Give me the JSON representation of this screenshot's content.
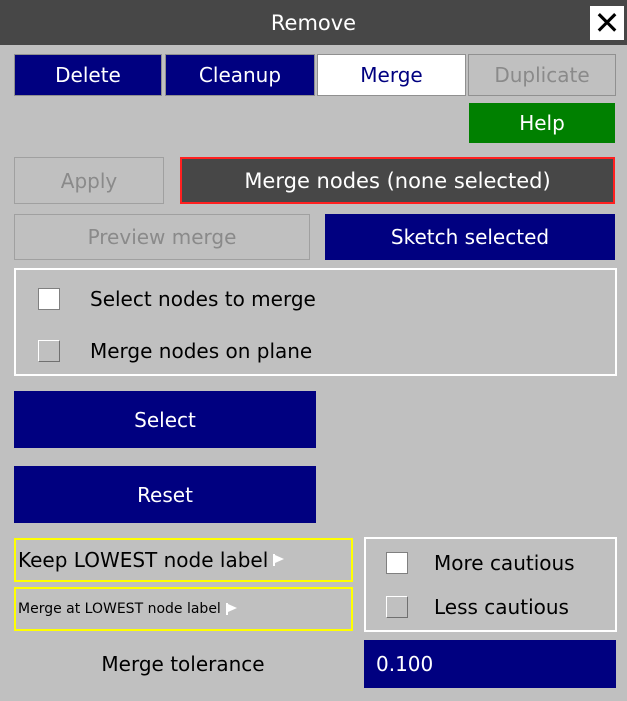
{
  "window": {
    "title": "Remove",
    "close_glyph": "✕"
  },
  "tabs": [
    {
      "label": "Delete",
      "state": "on"
    },
    {
      "label": "Cleanup",
      "state": "on"
    },
    {
      "label": "Merge",
      "state": "active"
    },
    {
      "label": "Duplicate",
      "state": "disabled"
    }
  ],
  "help_label": "Help",
  "apply_label": "Apply",
  "merge_status": "Merge nodes (none selected)",
  "preview_label": "Preview merge",
  "sketch_label": "Sketch selected",
  "mode_options": [
    {
      "label": "Select nodes to merge",
      "checked": true
    },
    {
      "label": "Merge nodes on plane",
      "checked": false
    }
  ],
  "select_label": "Select",
  "reset_label": "Reset",
  "keep_label": "Keep LOWEST node label",
  "merge_at_label": "Merge at LOWEST node label",
  "caution_options": [
    {
      "label": "More cautious",
      "checked": true
    },
    {
      "label": "Less cautious",
      "checked": false
    }
  ],
  "tolerance": {
    "label": "Merge tolerance",
    "value": "0.100"
  },
  "colors": {
    "background": "#c0c0c0",
    "title_bar": "#474747",
    "active_blue": "#000080",
    "help_green": "#008000",
    "status_border": "#ff2020",
    "dropdown_border": "#ffff00"
  }
}
